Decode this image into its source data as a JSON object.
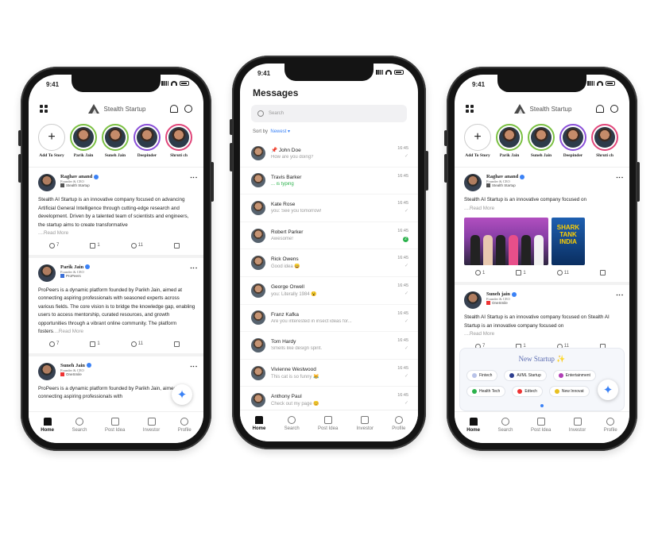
{
  "phone_left": {
    "time": "9:41",
    "brand": "Stealth Startup",
    "stories": [
      {
        "name": "Add To Story",
        "add": true
      },
      {
        "name": "Parik Jain",
        "ring": "green"
      },
      {
        "name": "Suneh Jain",
        "ring": "green"
      },
      {
        "name": "Deepinder",
        "ring": "purple"
      },
      {
        "name": "Shruti ch",
        "ring": "pink"
      }
    ],
    "posts": [
      {
        "name": "Raghav anand",
        "role": "Founder & CEO",
        "org": "Stealth Startup",
        "text": "Stealth AI Startup is an innovative company focused on advancing Artificial General Intelligence through cutting-edge research and development. Driven by a talented team of scientists and engineers, the startup aims to create transformative",
        "more": "....Read More",
        "comments": "7",
        "reposts": "1",
        "likes": "11"
      },
      {
        "name": "Parik Jain",
        "role": "Founder & CEO",
        "org": "ProPeers",
        "text": "ProPeers is a dynamic platform founded by Parikh Jain, aimed at connecting aspiring professionals with seasoned experts across various fields. The core vision is to bridge the knowledge gap, enabling users to access mentorship, curated resources, and growth opportunities through a vibrant online community. The platform fosters",
        "more": "....Read More",
        "comments": "7",
        "reposts": "1",
        "likes": "11"
      },
      {
        "name": "Suneh Jain",
        "role": "Founder & CEO",
        "org": "OneSmile",
        "text": "ProPeers is a dynamic platform founded by Parikh Jain, aimed at connecting aspiring professionals with"
      }
    ],
    "nav": [
      "Home",
      "Search",
      "Post Idea",
      "Investor",
      "Profile"
    ]
  },
  "phone_middle": {
    "time": "9:41",
    "title": "Messages",
    "search_placeholder": "Search",
    "sort_label": "Sort by",
    "sort_value": "Newest ▾",
    "messages": [
      {
        "name": "📌 John Doe",
        "preview": "How are you doing?",
        "time": "16:45",
        "tick": "✓"
      },
      {
        "name": "Travis Barker",
        "preview": "... is typing",
        "time": "16:45",
        "typing": true,
        "tick": ""
      },
      {
        "name": "Kate Rose",
        "preview": "you: See you tomorrow!",
        "time": "16:45",
        "tick": "✓"
      },
      {
        "name": "Robert Parker",
        "preview": "Awesome!",
        "time": "16:45",
        "badge": "2",
        "tick": ""
      },
      {
        "name": "Rick Owens",
        "preview": "Good idea 😄",
        "time": "16:45",
        "tick": "✓"
      },
      {
        "name": "George Orwell",
        "preview": "you: Literally 1984 😮",
        "time": "16:45",
        "tick": "✓"
      },
      {
        "name": "Franz Kafka",
        "preview": "Are you interested in insect ideas for...",
        "time": "16:45",
        "tick": "✓"
      },
      {
        "name": "Tom Hardy",
        "preview": "Smells like design spirit.",
        "time": "16:45",
        "tick": "✓"
      },
      {
        "name": "Vivienne Westwood",
        "preview": "This cat is so funny 😹",
        "time": "16:45",
        "tick": "✓"
      },
      {
        "name": "Anthony Paul",
        "preview": "Check out my page 😊",
        "time": "16:45",
        "tick": "✓"
      }
    ],
    "nav": [
      "Home",
      "Search",
      "Post Idea",
      "Investor",
      "Profile"
    ]
  },
  "phone_right": {
    "time": "9:41",
    "brand": "Stealth Startup",
    "stories": [
      {
        "name": "Add To Story",
        "add": true
      },
      {
        "name": "Parik Jain",
        "ring": "green"
      },
      {
        "name": "Suneh Jain",
        "ring": "green"
      },
      {
        "name": "Deepinder",
        "ring": "purple"
      },
      {
        "name": "Shruti ch",
        "ring": "pink"
      }
    ],
    "post1": {
      "name": "Raghav anand",
      "role": "Founder & CEO",
      "org": "Stealth Startup",
      "text": "Stealth AI Startup is an innovative company focused on",
      "more": "....Read More",
      "image_text": "SHARK TANK INDIA",
      "comments": "1",
      "reposts": "1",
      "likes": "11"
    },
    "post2": {
      "name": "Suneh jain",
      "role": "Founder & CEO",
      "org": "OneSmile",
      "text": "Stealth AI Startup is an innovative company focused on Stealth AI Startup is an innovative company focused on",
      "more": "....Read More",
      "comments": "7",
      "reposts": "1",
      "likes": "11"
    },
    "startup_panel": {
      "title": "New Startup ✨",
      "chips": [
        {
          "label": "Fintech",
          "color": "#b9c3e8"
        },
        {
          "label": "AI/ML Startup",
          "color": "#2d3e8f"
        },
        {
          "label": "Entertainment",
          "color": "#b03fb5"
        },
        {
          "label": "Health Tech",
          "color": "#2bb24c"
        },
        {
          "label": "Edtech",
          "color": "#e33"
        },
        {
          "label": "New Innovat",
          "color": "#e8c020"
        }
      ]
    },
    "nav": [
      "Home",
      "Search",
      "Post Idea",
      "Investor",
      "Profile"
    ]
  }
}
